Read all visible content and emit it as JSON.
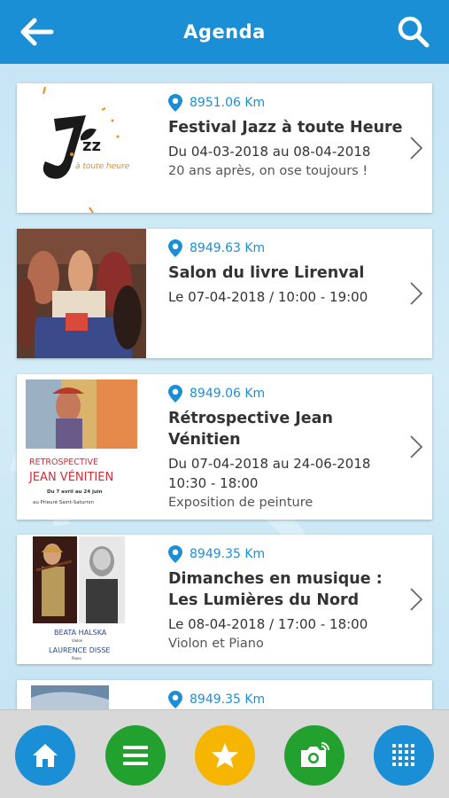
{
  "header": {
    "title": "Agenda",
    "back_icon": "arrow-left-icon",
    "search_icon": "search-icon"
  },
  "events": [
    {
      "distance": "8951.06 Km",
      "title": "Festival Jazz à toute Heure",
      "date": "Du 04-03-2018 au 08-04-2018",
      "description": "20 ans après, on ose toujours !"
    },
    {
      "distance": "8949.63 Km",
      "title": "Salon du livre Lirenval",
      "date": "Le 07-04-2018 / 10:00 - 19:00",
      "description": ""
    },
    {
      "distance": "8949.06 Km",
      "title_line1": "Rétrospective Jean",
      "title_line2": "Vénitien",
      "date": "Du 07-04-2018 au 24-06-2018",
      "time": "10:30 - 18:00",
      "description": "Exposition de peinture",
      "poster": {
        "line1": "RETROSPECTIVE",
        "line2": "JEAN VÉNITIEN",
        "line3": "Du 7 avril au 24 juin",
        "line4": "au Prieuré Saint-Saturnin"
      }
    },
    {
      "distance": "8949.35 Km",
      "title_line1": "Dimanches en musique :",
      "title_line2": "Les Lumières du Nord",
      "date": "Le 08-04-2018 / 17:00 - 18:00",
      "description": "Violon et Piano",
      "poster": {
        "name1": "BEATA HALSKA",
        "role1": "Violon",
        "name2": "LAURENCE DISSE",
        "role2": "Piano"
      }
    },
    {
      "distance": "8949.35 Km"
    }
  ],
  "jazz_logo": {
    "text": "Jazz",
    "subtitle": "à toute heure"
  },
  "bottom_nav": [
    {
      "name": "home",
      "icon": "home-icon",
      "color": "#1b8fd6"
    },
    {
      "name": "menu",
      "icon": "list-icon",
      "color": "#22a12f"
    },
    {
      "name": "favorites",
      "icon": "star-icon",
      "color": "#f6b500"
    },
    {
      "name": "camera",
      "icon": "camera-icon",
      "color": "#22a12f"
    },
    {
      "name": "grid",
      "icon": "grid-icon",
      "color": "#1b8fd6"
    }
  ],
  "colors": {
    "primary": "#1b8fd6",
    "background": "#c9e6f4",
    "bottom_bar": "#d8d8d8"
  }
}
